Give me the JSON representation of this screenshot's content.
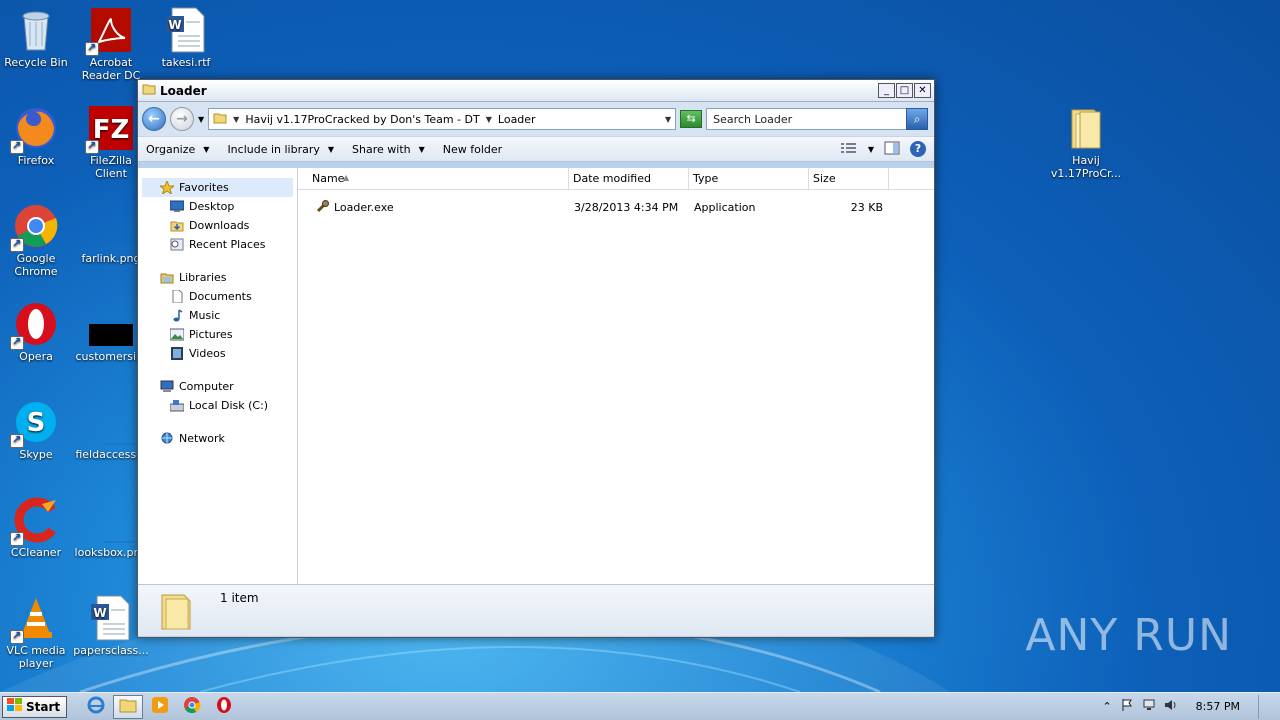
{
  "desktop": {
    "icons": [
      {
        "label": "Recycle Bin"
      },
      {
        "label": "Acrobat Reader DC"
      },
      {
        "label": "takesi.rtf"
      },
      {
        "label": "Firefox"
      },
      {
        "label": "FileZilla Client"
      },
      {
        "label": "Google Chrome"
      },
      {
        "label": "farlink.png"
      },
      {
        "label": "Opera"
      },
      {
        "label": "customersi..."
      },
      {
        "label": "Skype"
      },
      {
        "label": "fieldaccess..."
      },
      {
        "label": "CCleaner"
      },
      {
        "label": "looksbox.png"
      },
      {
        "label": "VLC media player"
      },
      {
        "label": "papersclass..."
      },
      {
        "label": "Havij v1.17ProCr..."
      }
    ],
    "watermark": "ANY RUN"
  },
  "window": {
    "title": "Loader",
    "address": {
      "crumbs": [
        "Havij v1.17ProCracked by Don's Team - DT",
        "Loader"
      ]
    },
    "search_placeholder": "Search Loader",
    "toolbar": {
      "organize": "Organize",
      "include_in_library": "Include in library",
      "share_with": "Share with",
      "new_folder": "New folder"
    },
    "nav": {
      "favorites": "Favorites",
      "desktop": "Desktop",
      "downloads": "Downloads",
      "recent_places": "Recent Places",
      "libraries": "Libraries",
      "documents": "Documents",
      "music": "Music",
      "pictures": "Pictures",
      "videos": "Videos",
      "computer": "Computer",
      "local_disk": "Local Disk (C:)",
      "network": "Network"
    },
    "columns": {
      "name": "Name",
      "date_modified": "Date modified",
      "type": "Type",
      "size": "Size"
    },
    "files": [
      {
        "name": "Loader.exe",
        "date_modified": "3/28/2013 4:34 PM",
        "type": "Application",
        "size": "23 KB"
      }
    ],
    "status": "1 item"
  },
  "taskbar": {
    "start": "Start",
    "clock": "8:57 PM"
  }
}
